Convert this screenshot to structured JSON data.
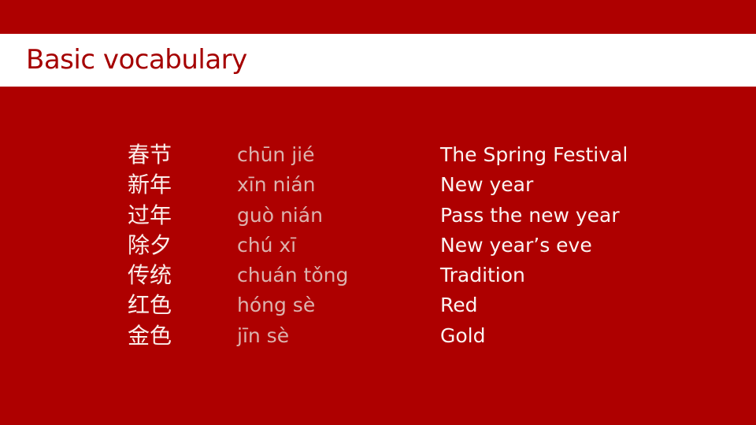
{
  "slide": {
    "title": "Basic vocabulary",
    "colors": {
      "background": "#ae0000",
      "title_band": "#ffffff",
      "title_text": "#a50000",
      "hanzi_text": "#fbeeea",
      "pinyin_text": "#dcb3ae",
      "english_text": "#fbf4f2"
    },
    "vocabulary": [
      {
        "hanzi": "春节",
        "pinyin": "chūn jié",
        "english": "The Spring Festival"
      },
      {
        "hanzi": "新年",
        "pinyin": "xīn nián",
        "english": "New year"
      },
      {
        "hanzi": "过年",
        "pinyin": "guò nián",
        "english": "Pass the new year"
      },
      {
        "hanzi": "除夕",
        "pinyin": "chú xī",
        "english": "New year’s eve"
      },
      {
        "hanzi": "传统",
        "pinyin": "chuán tǒng",
        "english": "Tradition"
      },
      {
        "hanzi": "红色",
        "pinyin": "hóng sè",
        "english": "Red"
      },
      {
        "hanzi": "金色",
        "pinyin": "jīn sè",
        "english": "Gold"
      }
    ]
  }
}
